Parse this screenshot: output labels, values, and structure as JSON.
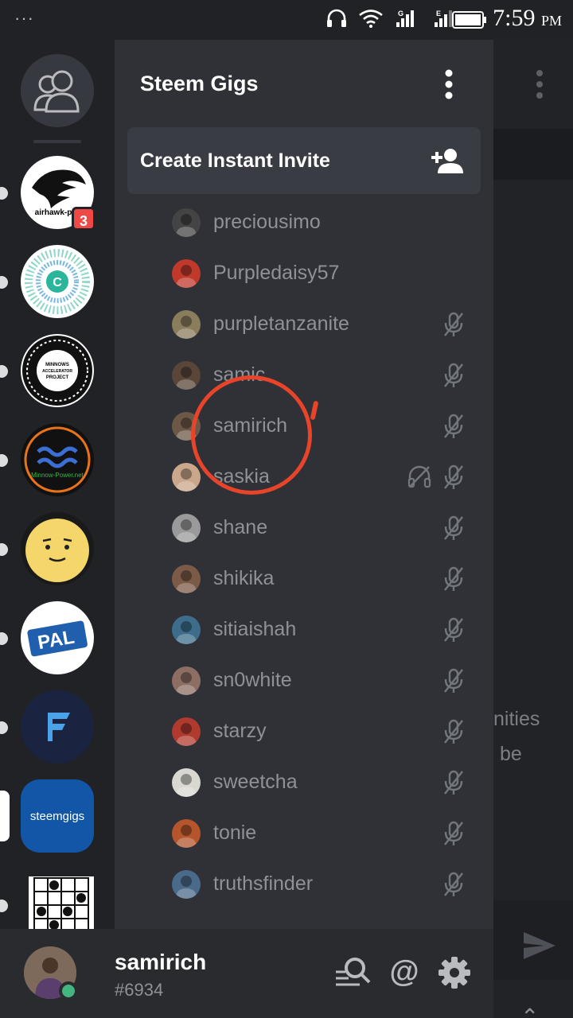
{
  "status_bar": {
    "menu_dots": "···",
    "time": "7:59",
    "ampm": "PM",
    "signal_labels": [
      "G",
      "E"
    ]
  },
  "guilds": [
    {
      "name": "airhawk-pro",
      "label": "airhawk-pro",
      "badge": "3"
    },
    {
      "name": "c-ring-server",
      "label": ""
    },
    {
      "name": "minnows-accelerator",
      "label": "MINNOWS ACCELERATOR PROJECT"
    },
    {
      "name": "minnow-power",
      "label": "Minnow-Power.net"
    },
    {
      "name": "potato-server",
      "label": ""
    },
    {
      "name": "pal",
      "label": "PAL"
    },
    {
      "name": "f-server",
      "label": ""
    },
    {
      "name": "steemgigs",
      "label": "steemgigs"
    },
    {
      "name": "grid-server",
      "label": ""
    }
  ],
  "drawer": {
    "server_name": "Steem Gigs",
    "invite_label": "Create Instant Invite",
    "members": [
      {
        "name": "preciousimo",
        "muted": false,
        "deafened": false,
        "color": "#444"
      },
      {
        "name": "Purpledaisy57",
        "muted": false,
        "deafened": false,
        "color": "#c0392b"
      },
      {
        "name": "purpletanzanite",
        "muted": true,
        "deafened": false,
        "color": "#8a7d5c"
      },
      {
        "name": "samic",
        "muted": true,
        "deafened": false,
        "color": "#5a4639"
      },
      {
        "name": "samirich",
        "muted": true,
        "deafened": false,
        "color": "#6d5848"
      },
      {
        "name": "saskia",
        "muted": true,
        "deafened": true,
        "color": "#caa78a"
      },
      {
        "name": "shane",
        "muted": true,
        "deafened": false,
        "color": "#9a9a9a"
      },
      {
        "name": "shikika",
        "muted": true,
        "deafened": false,
        "color": "#7b5a47"
      },
      {
        "name": "sitiaishah",
        "muted": true,
        "deafened": false,
        "color": "#3d6d8a"
      },
      {
        "name": "sn0white",
        "muted": true,
        "deafened": false,
        "color": "#8d6e63"
      },
      {
        "name": "starzy",
        "muted": true,
        "deafened": false,
        "color": "#b03a2e"
      },
      {
        "name": "sweetcha",
        "muted": true,
        "deafened": false,
        "color": "#d8d8d0"
      },
      {
        "name": "tonie",
        "muted": true,
        "deafened": false,
        "color": "#b4552c"
      },
      {
        "name": "truthsfinder",
        "muted": true,
        "deafened": false,
        "color": "#4a6a8a"
      }
    ]
  },
  "chat_peek": {
    "line1": "nities",
    "line2": "be"
  },
  "user": {
    "name": "samirich",
    "tag": "#6934"
  }
}
